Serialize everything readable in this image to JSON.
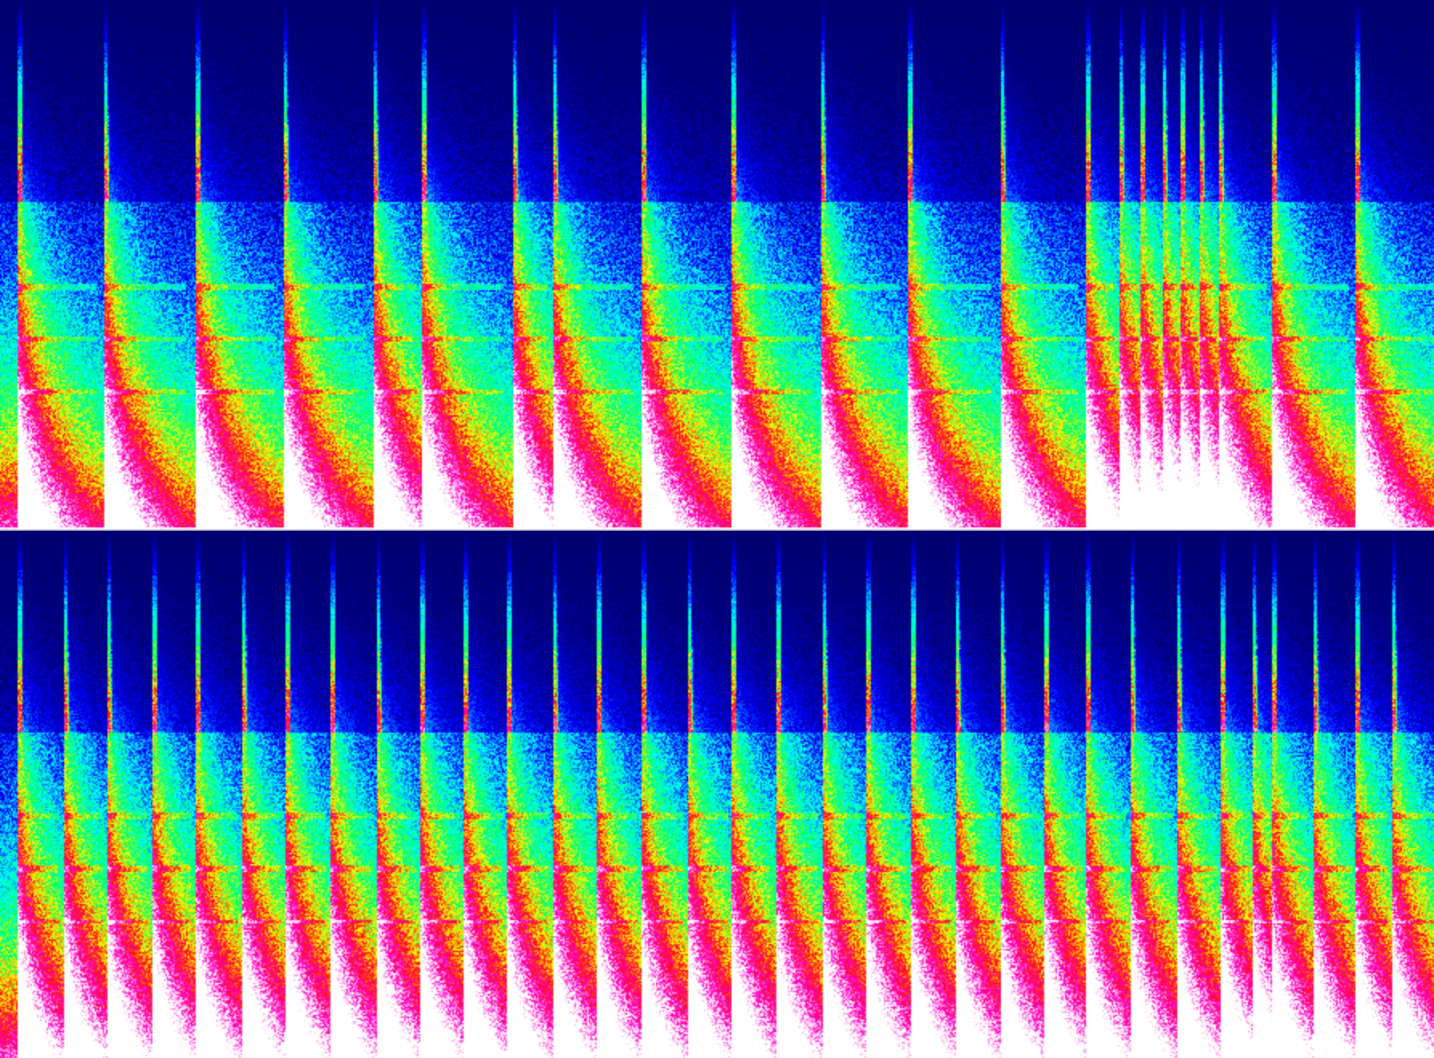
{
  "palette": {
    "background": "#000070",
    "low": "#0000ff",
    "cyan": "#00ffff",
    "green": "#00ff60",
    "yellow": "#ffff00",
    "red": "#ff1010",
    "magenta": "#ff00c8",
    "white": "#ffffff"
  },
  "panels": [
    {
      "name": "spectrogram-top",
      "onset_fractions": [
        0.012,
        0.072,
        0.136,
        0.197,
        0.26,
        0.294,
        0.357,
        0.385,
        0.447,
        0.51,
        0.572,
        0.633,
        0.697,
        0.757,
        0.78,
        0.795,
        0.81,
        0.823,
        0.836,
        0.849,
        0.887,
        0.945
      ]
    },
    {
      "name": "spectrogram-bottom",
      "onset_fractions": [
        0.012,
        0.044,
        0.074,
        0.106,
        0.136,
        0.168,
        0.199,
        0.23,
        0.262,
        0.293,
        0.323,
        0.353,
        0.385,
        0.416,
        0.447,
        0.479,
        0.51,
        0.541,
        0.573,
        0.604,
        0.635,
        0.666,
        0.697,
        0.728,
        0.757,
        0.788,
        0.82,
        0.851,
        0.873,
        0.887,
        0.915,
        0.945,
        0.97
      ]
    }
  ]
}
